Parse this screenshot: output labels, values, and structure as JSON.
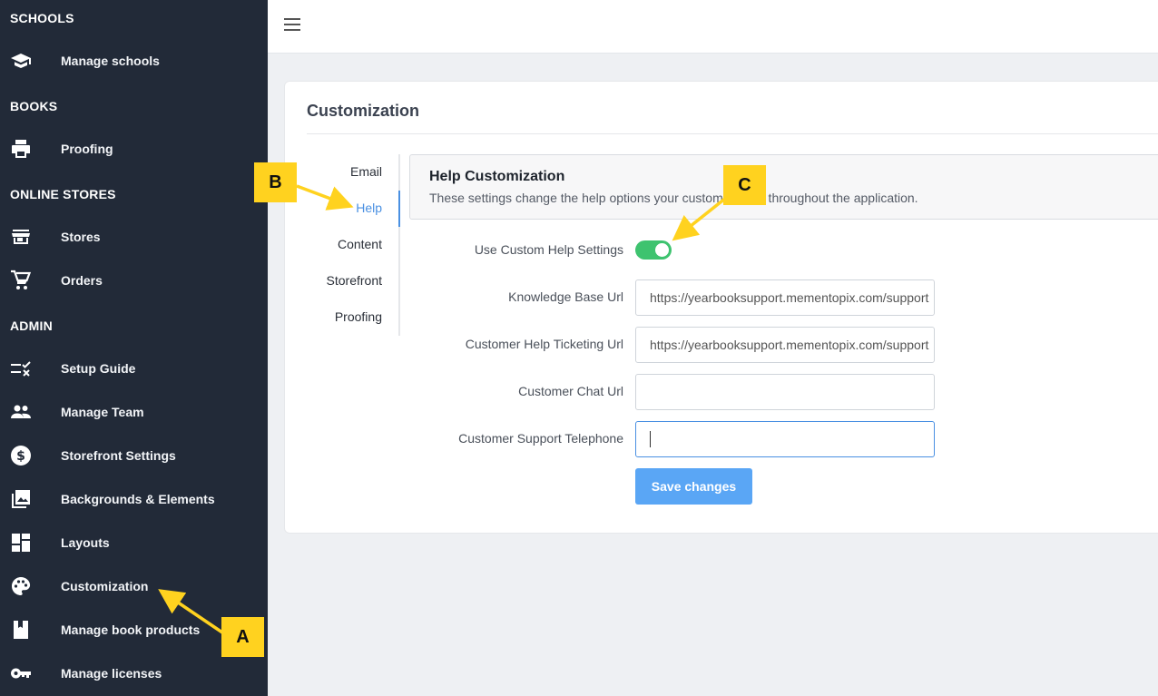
{
  "sidebar": {
    "sections": {
      "schools": "SCHOOLS",
      "books": "BOOKS",
      "online_stores": "ONLINE STORES",
      "admin": "ADMIN"
    },
    "items": {
      "manage_schools": {
        "label": "Manage schools",
        "icon": "graduation-cap-icon"
      },
      "proofing": {
        "label": "Proofing",
        "icon": "printer-icon"
      },
      "stores": {
        "label": "Stores",
        "icon": "store-icon"
      },
      "orders": {
        "label": "Orders",
        "icon": "cart-icon"
      },
      "setup_guide": {
        "label": "Setup Guide",
        "icon": "checklist-icon"
      },
      "manage_team": {
        "label": "Manage Team",
        "icon": "people-icon"
      },
      "storefront_settings": {
        "label": "Storefront Settings",
        "icon": "dollar-circle-icon"
      },
      "backgrounds": {
        "label": "Backgrounds & Elements",
        "icon": "photo-library-icon"
      },
      "layouts": {
        "label": "Layouts",
        "icon": "dashboard-icon"
      },
      "customization": {
        "label": "Customization",
        "icon": "palette-icon"
      },
      "book_products": {
        "label": "Manage book products",
        "icon": "book-icon"
      },
      "licenses": {
        "label": "Manage licenses",
        "icon": "key-icon"
      }
    }
  },
  "card": {
    "title": "Customization",
    "tabs": [
      "Email",
      "Help",
      "Content",
      "Storefront",
      "Proofing"
    ],
    "active_tab": "Help",
    "panel": {
      "title": "Help Customization",
      "subtitle": "These settings change the help options your customers see throughout the application."
    },
    "form": {
      "use_custom_label": "Use Custom Help Settings",
      "use_custom_value": true,
      "kb_label": "Knowledge Base Url",
      "kb_value": "https://yearbooksupport.mementopix.com/support",
      "ticket_label": "Customer Help Ticketing Url",
      "ticket_value": "https://yearbooksupport.mementopix.com/support",
      "chat_label": "Customer Chat Url",
      "chat_value": "",
      "phone_label": "Customer Support Telephone",
      "phone_value": "",
      "save_label": "Save changes"
    }
  },
  "callouts": {
    "a": "A",
    "b": "B",
    "c": "C"
  },
  "colors": {
    "sidebar": "#222a38",
    "accent": "#4a90e2",
    "toggle_on": "#3ec36f",
    "callout": "#ffd21f",
    "button": "#5aa6f5"
  }
}
